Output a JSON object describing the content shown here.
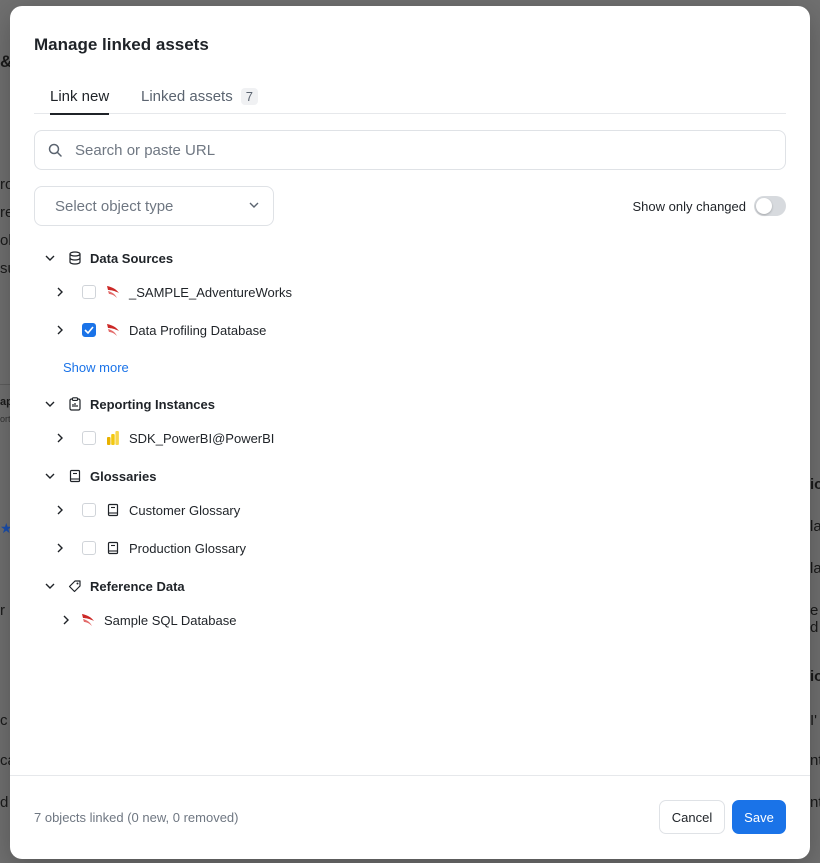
{
  "background": {
    "fragments": [
      "&",
      "ro",
      "re",
      "ol",
      "su",
      "ap",
      "ort",
      "io",
      "la",
      "la",
      "r",
      "e d",
      "io",
      "c",
      "I'",
      "ca",
      "nt",
      "d",
      "nt"
    ]
  },
  "modal": {
    "title": "Manage linked assets",
    "tabs": [
      {
        "label": "Link new",
        "active": true
      },
      {
        "label": "Linked assets",
        "count": "7",
        "active": false
      }
    ],
    "search": {
      "placeholder": "Search or paste URL",
      "value": ""
    },
    "object_type_select": {
      "placeholder": "Select object type"
    },
    "toggle": {
      "label": "Show only changed",
      "on": false
    },
    "groups": [
      {
        "label": "Data Sources",
        "icon": "database-icon",
        "items": [
          {
            "label": "_SAMPLE_AdventureWorks",
            "checked": false,
            "icon": "sql-server-icon"
          },
          {
            "label": "Data Profiling Database",
            "checked": true,
            "icon": "sql-server-icon"
          }
        ],
        "show_more": "Show more"
      },
      {
        "label": "Reporting Instances",
        "icon": "clipboard-icon",
        "items": [
          {
            "label": "SDK_PowerBI@PowerBI",
            "checked": false,
            "icon": "powerbi-icon"
          }
        ]
      },
      {
        "label": "Glossaries",
        "icon": "book-icon",
        "items": [
          {
            "label": "Customer Glossary",
            "checked": false,
            "icon": "book-icon"
          },
          {
            "label": "Production Glossary",
            "checked": false,
            "icon": "book-icon"
          }
        ]
      },
      {
        "label": "Reference Data",
        "icon": "tag-icon",
        "items": [
          {
            "label": "Sample SQL Database",
            "icon": "sql-server-icon"
          }
        ]
      }
    ],
    "footer": {
      "summary": "7 objects linked (0 new, 0 removed)",
      "cancel_label": "Cancel",
      "save_label": "Save"
    }
  },
  "colors": {
    "accent": "#1a73e8",
    "sql_server_red": "#cc2927",
    "powerbi_yellow": "#f2c811"
  }
}
